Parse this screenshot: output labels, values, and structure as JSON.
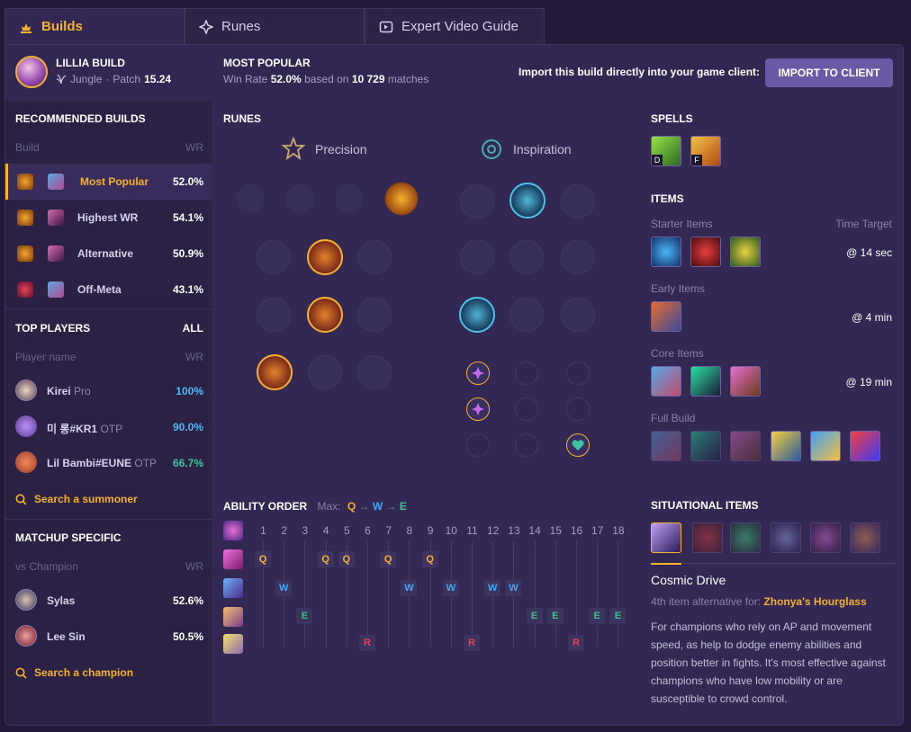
{
  "tabs": [
    {
      "label": "Builds",
      "icon": "builds-icon"
    },
    {
      "label": "Runes",
      "icon": "runes-icon"
    },
    {
      "label": "Expert Video Guide",
      "icon": "video-icon"
    }
  ],
  "header": {
    "champion": "LILLIA BUILD",
    "role": "Jungle",
    "patch_label": "Patch",
    "patch": "15.24",
    "most_popular": "MOST POPULAR",
    "winrate_label": "Win Rate",
    "winrate": "52.0%",
    "based_on": "based on",
    "matches": "10 729",
    "matches_label": "matches",
    "import_text": "Import this build directly into your game client:",
    "import_button": "IMPORT TO CLIENT"
  },
  "recommended": {
    "title": "RECOMMENDED BUILDS",
    "col_build": "Build",
    "col_wr": "WR",
    "rows": [
      {
        "label": "Most Popular",
        "wr": "52.0%"
      },
      {
        "label": "Highest WR",
        "wr": "54.1%"
      },
      {
        "label": "Alternative",
        "wr": "50.9%"
      },
      {
        "label": "Off-Meta",
        "wr": "43.1%"
      }
    ]
  },
  "top_players": {
    "title": "TOP PLAYERS",
    "all": "ALL",
    "col_name": "Player name",
    "col_wr": "WR",
    "rows": [
      {
        "name": "Kirei",
        "tag": "Pro",
        "wr": "100%"
      },
      {
        "name": "미 롱#KR1",
        "tag": "OTP",
        "wr": "90.0%"
      },
      {
        "name": "Lil Bambi#EUNE",
        "tag": "OTP",
        "wr": "66.7%"
      }
    ],
    "search": "Search a summoner"
  },
  "matchup": {
    "title": "MATCHUP SPECIFIC",
    "col_name": "vs Champion",
    "col_wr": "WR",
    "rows": [
      {
        "name": "Sylas",
        "wr": "52.6%"
      },
      {
        "name": "Lee Sin",
        "wr": "50.5%"
      }
    ],
    "search": "Search a champion"
  },
  "runes": {
    "title": "RUNES",
    "primary": "Precision",
    "secondary": "Inspiration"
  },
  "spells": {
    "title": "SPELLS",
    "keys": [
      "D",
      "F"
    ]
  },
  "items": {
    "title": "ITEMS",
    "starter": "Starter Items",
    "time_target": "Time Target",
    "starter_time": "@ 14 sec",
    "early": "Early Items",
    "early_time": "@ 4 min",
    "core": "Core Items",
    "core_time": "@ 19 min",
    "full": "Full Build"
  },
  "ability": {
    "title": "ABILITY ORDER",
    "max_label": "Max:",
    "max_order": [
      "Q",
      "W",
      "E"
    ],
    "levels": [
      "1",
      "2",
      "3",
      "4",
      "5",
      "6",
      "7",
      "8",
      "9",
      "10",
      "11",
      "12",
      "13",
      "14",
      "15",
      "16",
      "17",
      "18"
    ],
    "sequence": [
      "Q",
      "W",
      "E",
      "Q",
      "Q",
      "R",
      "Q",
      "W",
      "Q",
      "W",
      "R",
      "W",
      "W",
      "E",
      "E",
      "R",
      "E",
      "E"
    ]
  },
  "situational": {
    "title": "SITUATIONAL ITEMS",
    "item_name": "Cosmic Drive",
    "alt_label": "4th item alternative for:",
    "alt_item": "Zhonya's Hourglass",
    "description": "For champions who rely on AP and movement speed, as help to dodge enemy abilities and position better in fights. It's most effective against champions who have low mobility or are susceptible to crowd control."
  },
  "colors": {
    "accent": "#f5b12f",
    "q": "#f5b12f",
    "w": "#3fa9f5",
    "e": "#3fc28a",
    "r": "#e8405a"
  }
}
